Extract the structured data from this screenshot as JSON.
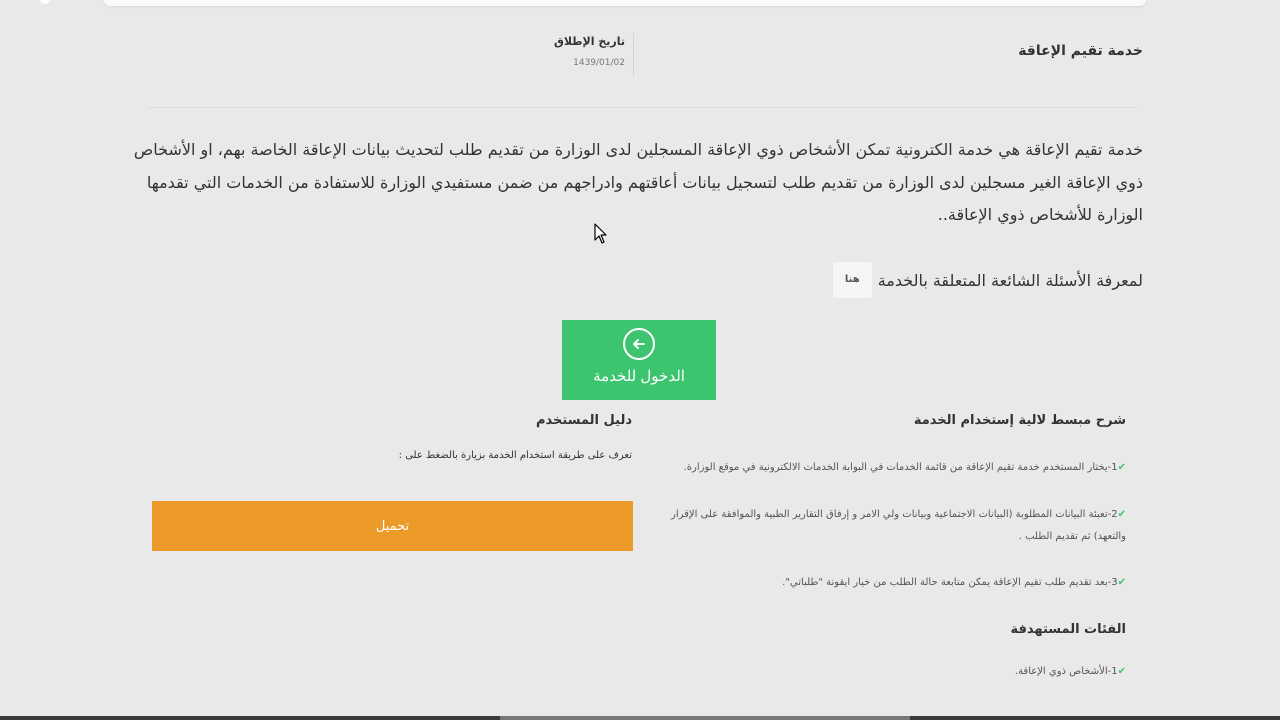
{
  "header": {
    "service_title": "خدمة تقيم الإعاقة",
    "launch_label": "تاريخ الإطلاق",
    "launch_date": "1439/01/02"
  },
  "description": "خدمة تقيم الإعاقة هي خدمة الكترونية تمكن الأشخاص ذوي الإعاقة المسجلين لدى الوزارة من تقديم طلب لتحديث بيانات الإعاقة الخاصة بهم، او الأشخاص ذوي الإعاقة الغير مسجلين لدى الوزارة من تقديم طلب لتسجيل بيانات أعاقتهم وادراجهم من ضمن مستفيدي الوزارة للاستفادة من الخدمات التي تقدمها الوزارة للأشخاص ذوي الإعاقة..",
  "faq": {
    "text": "لمعرفة الأسئلة الشائعة المتعلقة بالخدمة",
    "link_label": "هنا"
  },
  "enter_button": {
    "label": "الدخول للخدمة",
    "icon": "arrow-left-circle-icon",
    "color": "#3cc56e"
  },
  "steps_section": {
    "heading": "شرح مبسط لالية إستخدام الخدمة",
    "steps": [
      "1-يختار المستخدم خدمة تقيم الإعاقة من قائمة الخدمات في البوابة الخدمات الالكترونية في موقع الوزارة.",
      "2-تعبئة البيانات المطلوبة (البيانات الاجتماعية وبيانات ولي الامر و إرفاق التقارير الطبية والموافقة على الإقرار والتعهد) ثم تقديم الطلب .",
      "3-بعد تقديم طلب تقيم الإعاقة يمكن متابعة حالة الطلب من خيار ايقونة \"طلباتي\"."
    ],
    "check_icon": "✔"
  },
  "guide_section": {
    "heading": "دليل المستخدم",
    "text": "تعرف على طريقة استخدام الخدمة بزيارة بالضغط على :",
    "download_label": "تحميل",
    "download_color": "#ec9a2a"
  },
  "target_section": {
    "heading": "الفئات المستهدفة",
    "items": [
      "1-الأشخاص ذوي الإعاقة."
    ]
  }
}
